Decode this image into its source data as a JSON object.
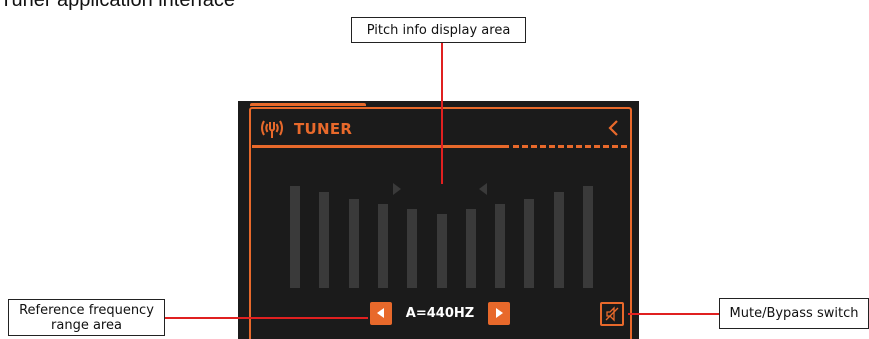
{
  "top_fragment": "Tuner application interface",
  "device": {
    "title": "TUNER",
    "reference_frequency": "A=440HZ",
    "bar_count": 11,
    "icons": {
      "title_icon": "tuner-waves-icon",
      "back": "chevron-left-icon",
      "freq_down": "triangle-left-icon",
      "freq_up": "triangle-right-icon",
      "mute": "speaker-muted-icon",
      "pitch_left_marker": "triangle-right-marker-icon",
      "pitch_right_marker": "triangle-left-marker-icon"
    },
    "colors": {
      "accent": "#e8692b",
      "background": "#1b1b1b",
      "bars": "#3a3a3a"
    }
  },
  "callouts": {
    "pitch": "Pitch info display area",
    "reference_line1": "Reference frequency",
    "reference_line2": "range area",
    "mute": "Mute/Bypass switch"
  }
}
